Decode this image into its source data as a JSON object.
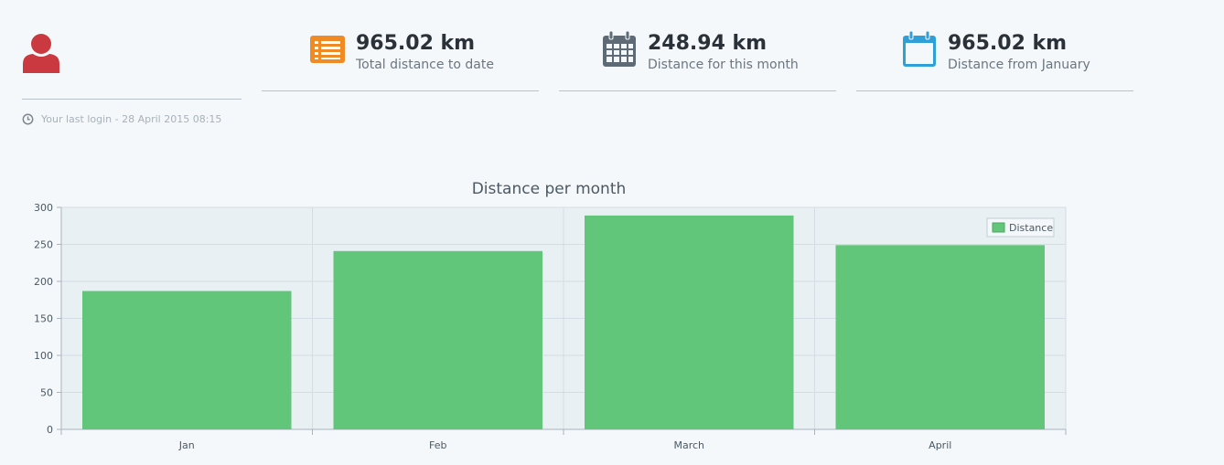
{
  "user": {
    "last_login": "Your last login - 28 April 2015 08:15"
  },
  "stats": [
    {
      "icon": "list-icon",
      "value": "965.02 km",
      "label": "Total distance to date",
      "color": "#f08a24"
    },
    {
      "icon": "calendar-icon",
      "value": "248.94 km",
      "label": "Distance for this month",
      "color": "#5e6b76"
    },
    {
      "icon": "calendar-blank-icon",
      "value": "965.02 km",
      "label": "Distance from January",
      "color": "#2f9fd8"
    }
  ],
  "colors": {
    "avatar": "#c9393f",
    "bar": "#62c67a",
    "plot_bg": "#e8f0f4",
    "grid": "#d3dde3"
  },
  "chart_data": {
    "type": "bar",
    "title": "Distance per month",
    "categories": [
      "Jan",
      "Feb",
      "March",
      "April"
    ],
    "series": [
      {
        "name": "Distance",
        "values": [
          187,
          241,
          289,
          249
        ]
      }
    ],
    "ylim": [
      0,
      300
    ],
    "yticks": [
      0,
      50,
      100,
      150,
      200,
      250,
      300
    ],
    "grid": true,
    "legend": "top-right"
  }
}
